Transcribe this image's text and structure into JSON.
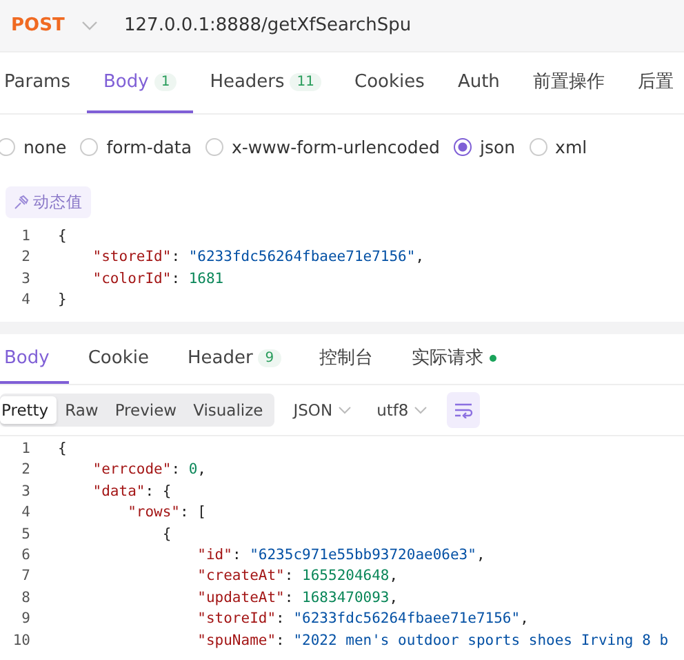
{
  "request": {
    "method": "POST",
    "url": "127.0.0.1:8888/getXfSearchSpu"
  },
  "request_tabs": [
    {
      "label": "Params",
      "selected": false
    },
    {
      "label": "Body",
      "badge": "1",
      "selected": true
    },
    {
      "label": "Headers",
      "badge": "11",
      "selected": false
    },
    {
      "label": "Cookies",
      "selected": false
    },
    {
      "label": "Auth",
      "selected": false
    },
    {
      "label": "前置操作",
      "selected": false
    },
    {
      "label": "后置",
      "selected": false
    }
  ],
  "body_types": [
    {
      "label": "none",
      "selected": false
    },
    {
      "label": "form-data",
      "selected": false
    },
    {
      "label": "x-www-form-urlencoded",
      "selected": false
    },
    {
      "label": "json",
      "selected": true
    },
    {
      "label": "xml",
      "selected": false
    }
  ],
  "dynamic_value_button": "动态值",
  "request_body": [
    {
      "number": "1",
      "tokens": [
        {
          "kind": "punct",
          "text": "{"
        }
      ]
    },
    {
      "number": "2",
      "tokens": [
        {
          "kind": "key",
          "text": "    \"storeId\""
        },
        {
          "kind": "punct",
          "text": ": "
        },
        {
          "kind": "string",
          "text": "\"6233fdc56264fbaee71e7156\""
        },
        {
          "kind": "punct",
          "text": ","
        }
      ]
    },
    {
      "number": "3",
      "tokens": [
        {
          "kind": "key",
          "text": "    \"colorId\""
        },
        {
          "kind": "punct",
          "text": ": "
        },
        {
          "kind": "number",
          "text": "1681"
        }
      ]
    },
    {
      "number": "4",
      "tokens": [
        {
          "kind": "punct",
          "text": "}"
        }
      ]
    }
  ],
  "response_tabs": [
    {
      "label": "Body",
      "selected": true,
      "dot": false
    },
    {
      "label": "Cookie",
      "selected": false,
      "dot": false
    },
    {
      "label": "Header",
      "badge": "9",
      "selected": false,
      "dot": false
    },
    {
      "label": "控制台",
      "selected": false,
      "dot": false
    },
    {
      "label": "实际请求",
      "selected": false,
      "dot": true
    }
  ],
  "view_modes": [
    {
      "label": "Pretty",
      "selected": true
    },
    {
      "label": "Raw",
      "selected": false
    },
    {
      "label": "Preview",
      "selected": false
    },
    {
      "label": "Visualize",
      "selected": false
    }
  ],
  "format_dropdown": "JSON",
  "encoding_dropdown": "utf8",
  "wrap_button": {
    "on": true
  },
  "response_body": [
    {
      "number": "1",
      "tokens": [
        {
          "kind": "punct",
          "text": "{"
        }
      ]
    },
    {
      "number": "2",
      "tokens": [
        {
          "kind": "key",
          "text": "    \"errcode\""
        },
        {
          "kind": "punct",
          "text": ": "
        },
        {
          "kind": "number",
          "text": "0"
        },
        {
          "kind": "punct",
          "text": ","
        }
      ]
    },
    {
      "number": "3",
      "tokens": [
        {
          "kind": "key",
          "text": "    \"data\""
        },
        {
          "kind": "punct",
          "text": ": {"
        }
      ]
    },
    {
      "number": "4",
      "tokens": [
        {
          "kind": "key",
          "text": "        \"rows\""
        },
        {
          "kind": "punct",
          "text": ": ["
        }
      ]
    },
    {
      "number": "5",
      "tokens": [
        {
          "kind": "punct",
          "text": "            {"
        }
      ]
    },
    {
      "number": "6",
      "tokens": [
        {
          "kind": "key",
          "text": "                \"id\""
        },
        {
          "kind": "punct",
          "text": ": "
        },
        {
          "kind": "string",
          "text": "\"6235c971e55bb93720ae06e3\""
        },
        {
          "kind": "punct",
          "text": ","
        }
      ]
    },
    {
      "number": "7",
      "tokens": [
        {
          "kind": "key",
          "text": "                \"createAt\""
        },
        {
          "kind": "punct",
          "text": ": "
        },
        {
          "kind": "number",
          "text": "1655204648"
        },
        {
          "kind": "punct",
          "text": ","
        }
      ]
    },
    {
      "number": "8",
      "tokens": [
        {
          "kind": "key",
          "text": "                \"updateAt\""
        },
        {
          "kind": "punct",
          "text": ": "
        },
        {
          "kind": "number",
          "text": "1683470093"
        },
        {
          "kind": "punct",
          "text": ","
        }
      ]
    },
    {
      "number": "9",
      "tokens": [
        {
          "kind": "key",
          "text": "                \"storeId\""
        },
        {
          "kind": "punct",
          "text": ": "
        },
        {
          "kind": "string",
          "text": "\"6233fdc56264fbaee71e7156\""
        },
        {
          "kind": "punct",
          "text": ","
        }
      ]
    },
    {
      "number": "10",
      "tokens": [
        {
          "kind": "key",
          "text": "                \"spuName\""
        },
        {
          "kind": "punct",
          "text": ": "
        },
        {
          "kind": "string",
          "text": "\"2022 men's outdoor sports shoes Irving 8 b"
        }
      ]
    }
  ]
}
